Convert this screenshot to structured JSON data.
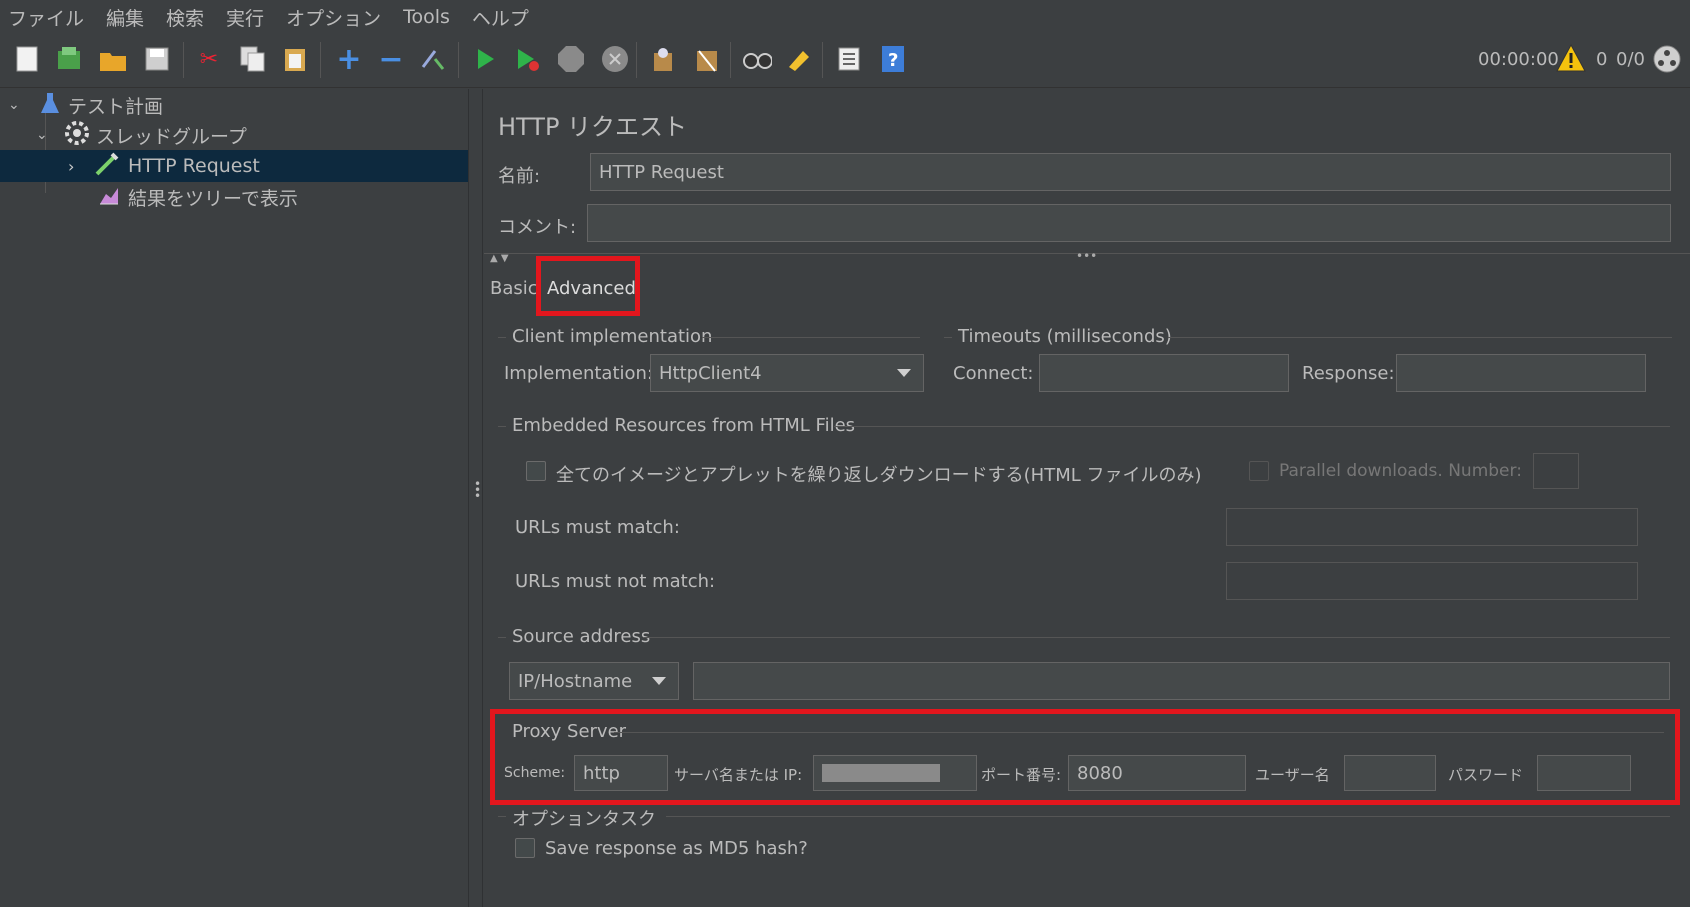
{
  "menu": [
    "ファイル",
    "編集",
    "検索",
    "実行",
    "オプション",
    "Tools",
    "ヘルプ"
  ],
  "toolbar": {
    "icons": [
      "new-icon",
      "templates-icon",
      "open-icon",
      "save-icon",
      "cut-icon",
      "copy-icon",
      "paste-icon",
      "expand-icon",
      "collapse-icon",
      "toggle-icon",
      "start-icon",
      "start-no-pause-icon",
      "stop-icon",
      "shutdown-icon",
      "clear-icon",
      "clear-all-icon",
      "search-icon",
      "reset-search-icon",
      "function-helper-icon",
      "help-icon"
    ],
    "timer": "00:00:00",
    "warning_count": "0",
    "thread_count": "0/0"
  },
  "tree": {
    "items": [
      {
        "label": "テスト計画",
        "icon": "test-plan-icon"
      },
      {
        "label": "スレッドグループ",
        "icon": "gear-icon"
      },
      {
        "label": "HTTP Request",
        "icon": "pipette-icon"
      },
      {
        "label": "結果をツリーで表示",
        "icon": "graph-icon"
      }
    ]
  },
  "panel": {
    "title": "HTTP リクエスト",
    "name_label": "名前:",
    "name_value": "HTTP Request",
    "comment_label": "コメント:",
    "comment_value": "",
    "tabs": {
      "basic": "Basic",
      "advanced": "Advanced"
    },
    "client": {
      "section": "Client implementation",
      "impl_label": "Implementation:",
      "impl_value": "HttpClient4"
    },
    "timeouts": {
      "section": "Timeouts (milliseconds)",
      "connect_label": "Connect:",
      "response_label": "Response:"
    },
    "embedded": {
      "section": "Embedded Resources from HTML Files",
      "retrieve_label": "全てのイメージとアプレットを繰り返しダウンロードする(HTML ファイルのみ)",
      "parallel_label": "Parallel downloads. Number:",
      "urls_match_label": "URLs must match:",
      "urls_not_match_label": "URLs must not match:"
    },
    "source": {
      "section": "Source address",
      "type_value": "IP/Hostname"
    },
    "proxy": {
      "section": "Proxy Server",
      "scheme_label": "Scheme:",
      "scheme_value": "http",
      "server_label": "サーバ名または IP:",
      "port_label": "ポート番号:",
      "port_value": "8080",
      "user_label": "ユーザー名",
      "password_label": "パスワード"
    },
    "optional": {
      "section": "オプションタスク",
      "md5_label": "Save response as MD5 hash?"
    }
  },
  "colors": {
    "highlight": "#e3161d",
    "selection": "#0d293e",
    "background": "#3c3f41"
  }
}
